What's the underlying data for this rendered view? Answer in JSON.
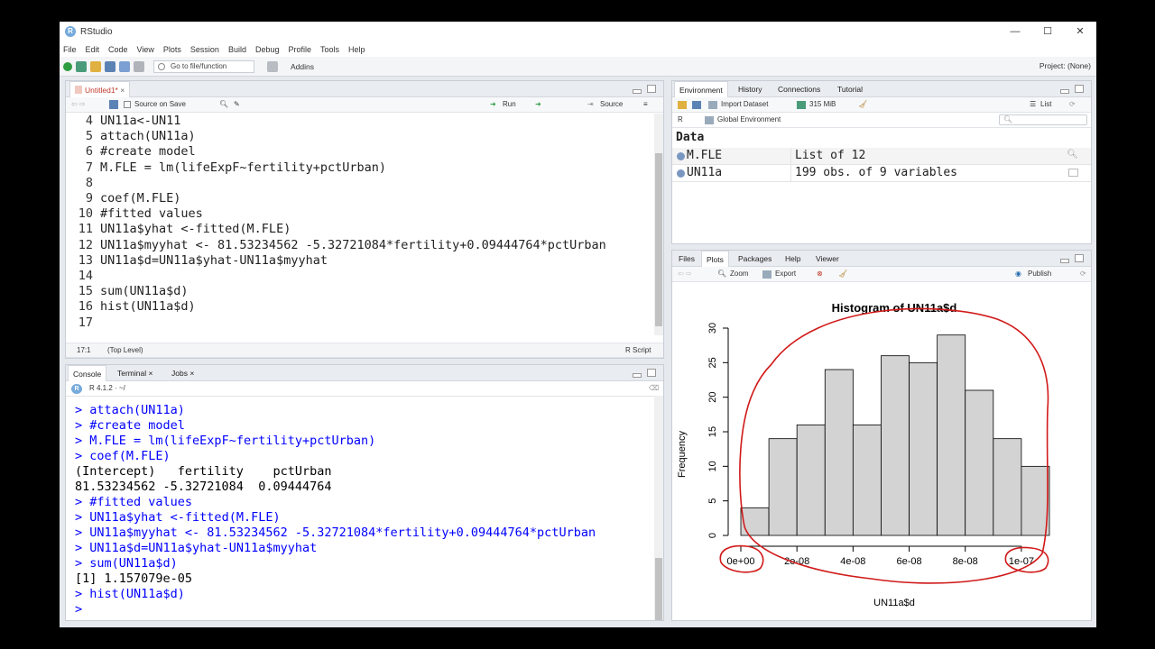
{
  "window": {
    "title": "RStudio",
    "controls": [
      "—",
      "☐",
      "✕"
    ]
  },
  "menu": [
    "File",
    "Edit",
    "Code",
    "View",
    "Plots",
    "Session",
    "Build",
    "Debug",
    "Profile",
    "Tools",
    "Help"
  ],
  "toolbar": {
    "goto_placeholder": "Go to file/function",
    "addins": "Addins",
    "project": "Project: (None)"
  },
  "editor": {
    "tab": "Untitled1*",
    "source_on_save": "Source on Save",
    "run": "Run",
    "source": "Source",
    "status_pos": "17:1",
    "status_scope": "(Top Level)",
    "status_type": "R Script",
    "lines": [
      {
        "n": "4",
        "t": "UN11a<-UN11"
      },
      {
        "n": "5",
        "t": "attach(UN11a)"
      },
      {
        "n": "6",
        "t": "#create model"
      },
      {
        "n": "7",
        "t": "M.FLE = lm(lifeExpF~fertility+pctUrban)"
      },
      {
        "n": "8",
        "t": ""
      },
      {
        "n": "9",
        "t": "coef(M.FLE)"
      },
      {
        "n": "10",
        "t": "#fitted values"
      },
      {
        "n": "11",
        "t": "UN11a$yhat <-fitted(M.FLE)"
      },
      {
        "n": "12",
        "t": "UN11a$myyhat <- 81.53234562 -5.32721084*fertility+0.09444764*pctUrban"
      },
      {
        "n": "13",
        "t": "UN11a$d=UN11a$yhat-UN11a$myyhat"
      },
      {
        "n": "14",
        "t": ""
      },
      {
        "n": "15",
        "t": "sum(UN11a$d)"
      },
      {
        "n": "16",
        "t": "hist(UN11a$d)"
      },
      {
        "n": "17",
        "t": ""
      }
    ]
  },
  "console": {
    "tabs": [
      "Console",
      "Terminal",
      "Jobs"
    ],
    "rversion": "R 4.1.2 · ~/",
    "lines": [
      {
        "p": "> ",
        "t": "attach(UN11a)"
      },
      {
        "p": "> ",
        "t": "#create model"
      },
      {
        "p": "> ",
        "t": "M.FLE = lm(lifeExpF~fertility+pctUrban)"
      },
      {
        "p": "> ",
        "t": "coef(M.FLE)"
      },
      {
        "p": "",
        "t": "(Intercept)   fertility    pctUrban "
      },
      {
        "p": "",
        "t": "81.53234562 -5.32721084  0.09444764 "
      },
      {
        "p": "> ",
        "t": "#fitted values"
      },
      {
        "p": "> ",
        "t": "UN11a$yhat <-fitted(M.FLE)"
      },
      {
        "p": "> ",
        "t": "UN11a$myyhat <- 81.53234562 -5.32721084*fertility+0.09444764*pctUrban"
      },
      {
        "p": "> ",
        "t": "UN11a$d=UN11a$yhat-UN11a$myyhat"
      },
      {
        "p": "> ",
        "t": "sum(UN11a$d)"
      },
      {
        "p": "",
        "t": "[1] 1.157079e-05"
      },
      {
        "p": "> ",
        "t": "hist(UN11a$d)"
      },
      {
        "p": "> ",
        "t": ""
      }
    ]
  },
  "environment": {
    "tabs": [
      "Environment",
      "History",
      "Connections",
      "Tutorial"
    ],
    "import_dataset": "Import Dataset",
    "memory": "315 MiB",
    "list_view": "List",
    "lang": "R",
    "scope": "Global Environment",
    "section": "Data",
    "rows": [
      {
        "name": "M.FLE",
        "value": "List of  12"
      },
      {
        "name": "UN11a",
        "value": "199 obs. of 9 variables"
      }
    ]
  },
  "plots": {
    "tabs": [
      "Files",
      "Plots",
      "Packages",
      "Help",
      "Viewer"
    ],
    "zoom": "Zoom",
    "export": "Export",
    "publish": "Publish"
  },
  "chart_data": {
    "type": "bar",
    "title": "Histogram of UN11a$d",
    "xlabel": "UN11a$d",
    "ylabel": "Frequency",
    "bin_width": 1e-08,
    "x_start": 0,
    "values": [
      4,
      14,
      16,
      24,
      16,
      26,
      25,
      29,
      21,
      14,
      10
    ],
    "ylim": [
      0,
      30
    ],
    "y_ticks": [
      "0",
      "5",
      "10",
      "15",
      "20",
      "25",
      "30"
    ],
    "x_ticks": [
      "0e+00",
      "2e-08",
      "4e-08",
      "6e-08",
      "8e-08",
      "1e-07"
    ],
    "bar_color": "#d3d3d3",
    "annotation_color": "#d11a1a"
  }
}
